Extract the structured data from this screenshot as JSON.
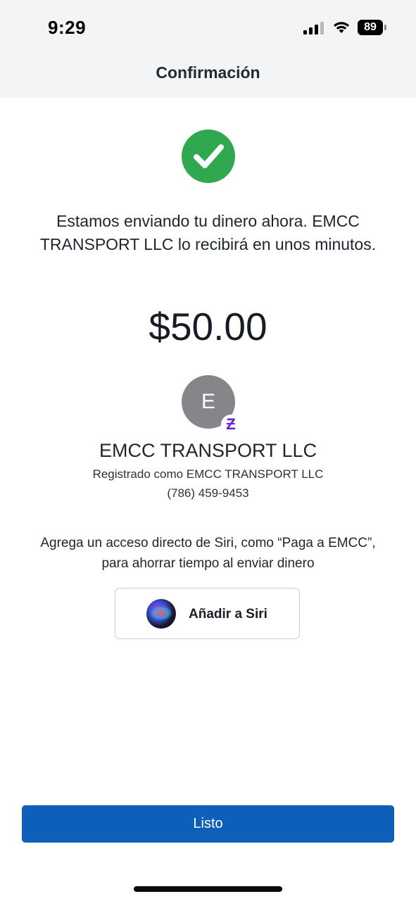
{
  "status_bar": {
    "time": "9:29",
    "battery": "89",
    "icons": [
      "signal-icon",
      "wifi-icon",
      "battery-icon"
    ]
  },
  "header": {
    "title": "Confirmación"
  },
  "confirmation": {
    "icon": "check-circle-icon",
    "message": "Estamos enviando tu dinero ahora. EMCC TRANSPORT LLC lo recibirá en unos minutos.",
    "amount": "$50.00"
  },
  "recipient": {
    "initial": "E",
    "badge_icon": "zelle-icon",
    "badge_glyph": "Ƶ",
    "name": "EMCC TRANSPORT LLC",
    "registered_as": "Registrado como EMCC TRANSPORT LLC",
    "phone": "(786) 459-9453"
  },
  "siri": {
    "hint": "Agrega un acceso directo de Siri, como “Paga a EMCC”, para ahorrar tiempo al enviar dinero",
    "button_label": "Añadir a Siri",
    "icon": "siri-icon"
  },
  "footer": {
    "done_label": "Listo"
  },
  "colors": {
    "header_bg": "#f3f4f6",
    "success_green": "#2fa84f",
    "primary_blue": "#0d5fba",
    "zelle_purple": "#6d1ed4",
    "avatar_gray": "#848689"
  }
}
